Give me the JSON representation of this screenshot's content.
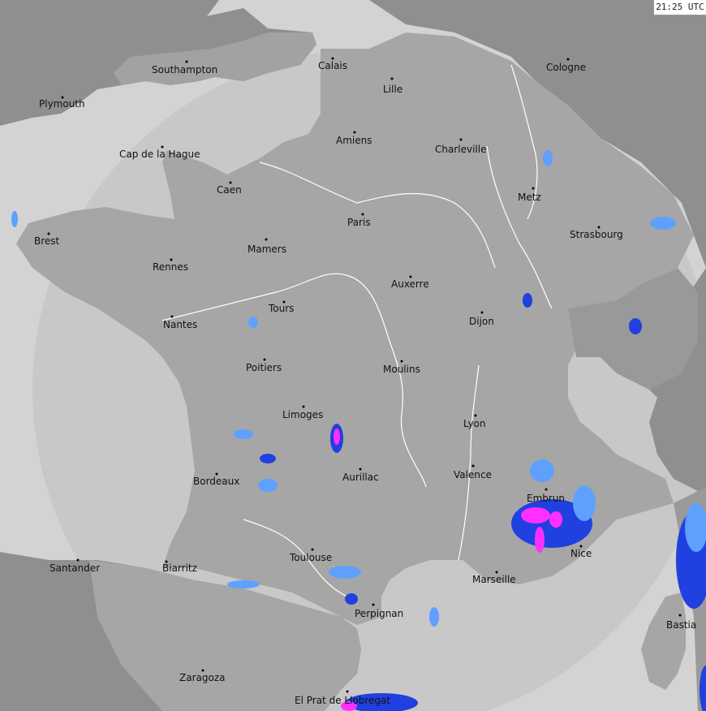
{
  "timestamp": "21:25 UTC",
  "colors": {
    "sea": "#d3d3d3",
    "land_outside": "#8f8f8f",
    "land_in_range": "#a6a6a6",
    "sea_in_range": "#c2c2c2",
    "rivers": "#ffffff",
    "radar_low": "#5fa0ff",
    "radar_mid": "#2040e0",
    "radar_high": "#ff30ff"
  },
  "cities": [
    {
      "name": "Southampton"
    },
    {
      "name": "Calais"
    },
    {
      "name": "Cologne"
    },
    {
      "name": "Lille"
    },
    {
      "name": "Plymouth"
    },
    {
      "name": "Amiens"
    },
    {
      "name": "Charleville"
    },
    {
      "name": "Cap de la Hague"
    },
    {
      "name": "Metz"
    },
    {
      "name": "Caen"
    },
    {
      "name": "Paris"
    },
    {
      "name": "Strasbourg"
    },
    {
      "name": "Brest"
    },
    {
      "name": "Mamers"
    },
    {
      "name": "Rennes"
    },
    {
      "name": "Auxerre"
    },
    {
      "name": "Tours"
    },
    {
      "name": "Nantes"
    },
    {
      "name": "Dijon"
    },
    {
      "name": "Poitiers"
    },
    {
      "name": "Moulins"
    },
    {
      "name": "Limoges"
    },
    {
      "name": "Lyon"
    },
    {
      "name": "Valence"
    },
    {
      "name": "Aurillac"
    },
    {
      "name": "Bordeaux"
    },
    {
      "name": "Embrun"
    },
    {
      "name": "Nice"
    },
    {
      "name": "Toulouse"
    },
    {
      "name": "Santander"
    },
    {
      "name": "Biarritz"
    },
    {
      "name": "Marseille"
    },
    {
      "name": "Perpignan"
    },
    {
      "name": "Bastia"
    },
    {
      "name": "Zaragoza"
    },
    {
      "name": "El Prat de Llobregat"
    }
  ]
}
